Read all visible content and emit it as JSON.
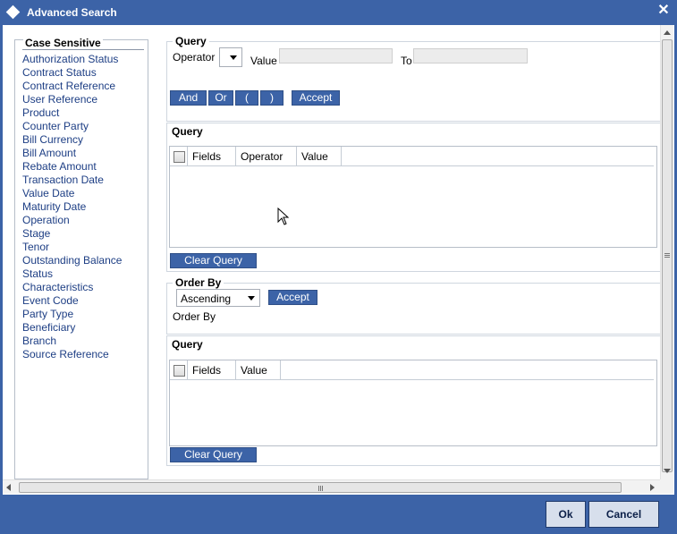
{
  "window": {
    "title": "Advanced Search",
    "close_glyph": "✕"
  },
  "left_panel": {
    "title": "Case Sensitive",
    "fields": [
      "Authorization Status",
      "Contract Status",
      "Contract Reference",
      "User Reference",
      "Product",
      "Counter Party",
      "Bill Currency",
      "Bill Amount",
      "Rebate Amount",
      "Transaction Date",
      "Value Date",
      "Maturity Date",
      "Operation",
      "Stage",
      "Tenor",
      "Outstanding Balance",
      "Status",
      "Characteristics",
      "Event Code",
      "Party Type",
      "Beneficiary",
      "Branch",
      "Source Reference"
    ]
  },
  "query_builder": {
    "section_label": "Query",
    "operator_label": "Operator",
    "operator_value": "",
    "value_label": "Value",
    "value_input": "",
    "to_label": "To",
    "to_input": "",
    "buttons": {
      "and": "And",
      "or": "Or",
      "open_paren": "(",
      "close_paren": ")",
      "accept": "Accept"
    }
  },
  "query_table": {
    "section_label": "Query",
    "columns": [
      "Fields",
      "Operator",
      "Value"
    ],
    "rows": [],
    "clear_label": "Clear Query"
  },
  "order_by": {
    "section_label": "Order By",
    "direction_value": "Ascending",
    "accept_label": "Accept",
    "text": "Order By"
  },
  "order_table": {
    "section_label": "Query",
    "columns": [
      "Fields",
      "Value"
    ],
    "rows": [],
    "clear_label": "Clear Query"
  },
  "footer": {
    "ok_label": "Ok",
    "cancel_label": "Cancel"
  },
  "icons": {
    "window": "diamond-icon",
    "close": "close-icon",
    "cursor": "mouse-pointer-icon"
  },
  "colors": {
    "title_bar": "#3c63a7",
    "button": "#3c63a7",
    "link_text": "#1d3e84",
    "footer_button": "#d7dfec"
  }
}
